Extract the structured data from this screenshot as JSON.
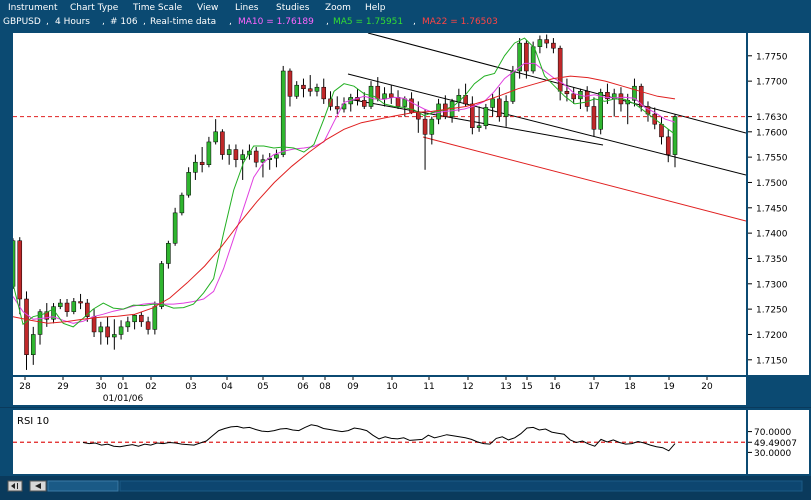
{
  "menu": {
    "items": [
      "Instrument",
      "Chart Type",
      "Time Scale",
      "View",
      "Lines",
      "Studies",
      "Zoom",
      "Help"
    ]
  },
  "info": {
    "symbol": "GBPUSD",
    "timeframe": "4 Hours",
    "bars": "# 106",
    "mode": "Real-time data",
    "ma10": "MA10 = 1.76189",
    "ma5": "MA5 = 1.75951",
    "ma22": "MA22 = 1.76503"
  },
  "colors": {
    "up_candle": "#2fb52f",
    "down_candle": "#c0282a",
    "ma5": "#22b022",
    "ma10": "#e040e0",
    "ma22": "#e02020",
    "frame": "#0b4a72"
  },
  "chart_data": [
    {
      "type": "line",
      "title": "",
      "y_tick_labels": [
        "1.7750",
        "1.7700",
        "1.7630",
        "1.7600",
        "1.7550",
        "1.7500",
        "1.7450",
        "1.7400",
        "1.7350",
        "1.7300",
        "1.7250",
        "1.7200",
        "1.7150"
      ],
      "x_tick_labels": [
        "28",
        "29",
        "30",
        "01",
        "02",
        "03",
        "04",
        "05",
        "06",
        "08",
        "09",
        "10",
        "11",
        "12",
        "13",
        "15",
        "16",
        "17",
        "18",
        "19",
        "20"
      ],
      "date_label": "01/01/06",
      "ylim": [
        1.712,
        1.7795
      ],
      "highlight_price": 1.763,
      "series": [
        {
          "name": "MA10",
          "values": [
            1.7275,
            1.7245,
            1.723,
            1.7232,
            1.7235,
            1.7228,
            1.7222,
            1.7226,
            1.7235,
            1.724,
            1.7246,
            1.725,
            1.7256,
            1.726,
            1.7262,
            1.726,
            1.726,
            1.7262,
            1.7265,
            1.727,
            1.7285,
            1.733,
            1.739,
            1.745,
            1.751,
            1.754,
            1.7555,
            1.7562,
            1.7566,
            1.7568,
            1.7571,
            1.758,
            1.762,
            1.7658,
            1.7664,
            1.767,
            1.7665,
            1.7664,
            1.7668,
            1.7666,
            1.7655,
            1.7645,
            1.7637,
            1.764,
            1.7642,
            1.7645,
            1.7651,
            1.766,
            1.768,
            1.7705,
            1.772,
            1.7735,
            1.7735,
            1.772,
            1.7705,
            1.7693,
            1.7675,
            1.767,
            1.7673,
            1.7668,
            1.7667,
            1.7668,
            1.7666,
            1.7648,
            1.7638,
            1.7625,
            1.7619
          ]
        },
        {
          "name": "MA5",
          "values": [
            1.73,
            1.722,
            1.7235,
            1.724,
            1.725,
            1.7222,
            1.7215,
            1.7232,
            1.725,
            1.7262,
            1.7252,
            1.725,
            1.7258,
            1.7257,
            1.726,
            1.7259,
            1.7252,
            1.7253,
            1.726,
            1.7282,
            1.731,
            1.74,
            1.7485,
            1.754,
            1.7572,
            1.7572,
            1.7568,
            1.757,
            1.7568,
            1.756,
            1.7575,
            1.7625,
            1.768,
            1.7695,
            1.769,
            1.7675,
            1.767,
            1.7655,
            1.765,
            1.7648,
            1.7643,
            1.7632,
            1.7639,
            1.7643,
            1.7652,
            1.767,
            1.7695,
            1.771,
            1.7715,
            1.775,
            1.7775,
            1.7785,
            1.7765,
            1.771,
            1.769,
            1.767,
            1.7655,
            1.7658,
            1.7665,
            1.766,
            1.7665,
            1.7664,
            1.7655,
            1.764,
            1.7625,
            1.761,
            1.7595
          ]
        },
        {
          "name": "MA22",
          "values": [
            1.7235,
            1.7228,
            1.7222,
            1.7225,
            1.723,
            1.7234,
            1.7236,
            1.724,
            1.7252,
            1.7272,
            1.7302,
            1.7335,
            1.7375,
            1.742,
            1.7462,
            1.75,
            1.7532,
            1.756,
            1.7585,
            1.7605,
            1.7618,
            1.7625,
            1.7632,
            1.7638,
            1.764,
            1.7645,
            1.765,
            1.766,
            1.7672,
            1.7685,
            1.7695,
            1.7705,
            1.771,
            1.7707,
            1.77,
            1.769,
            1.768,
            1.767,
            1.7665
          ]
        }
      ],
      "candles_ohlc": [
        [
          1.7295,
          1.739,
          1.729,
          1.7385
        ],
        [
          1.7385,
          1.7392,
          1.724,
          1.727
        ],
        [
          1.727,
          1.7285,
          1.713,
          1.716
        ],
        [
          1.716,
          1.7215,
          1.714,
          1.72
        ],
        [
          1.72,
          1.725,
          1.718,
          1.7245
        ],
        [
          1.7245,
          1.7262,
          1.7215,
          1.723
        ],
        [
          1.723,
          1.7262,
          1.7222,
          1.7255
        ],
        [
          1.7255,
          1.727,
          1.725,
          1.7262
        ],
        [
          1.7262,
          1.727,
          1.7235,
          1.7245
        ],
        [
          1.7245,
          1.7272,
          1.724,
          1.7265
        ],
        [
          1.7265,
          1.728,
          1.725,
          1.7262
        ],
        [
          1.7262,
          1.727,
          1.7225,
          1.7235
        ],
        [
          1.7235,
          1.725,
          1.7195,
          1.7205
        ],
        [
          1.7205,
          1.7225,
          1.718,
          1.7215
        ],
        [
          1.7215,
          1.7235,
          1.718,
          1.7195
        ],
        [
          1.7195,
          1.723,
          1.717,
          1.72
        ],
        [
          1.72,
          1.7228,
          1.719,
          1.7215
        ],
        [
          1.7215,
          1.7235,
          1.7205,
          1.7225
        ],
        [
          1.7225,
          1.724,
          1.721,
          1.7238
        ],
        [
          1.7238,
          1.7245,
          1.7215,
          1.7225
        ],
        [
          1.7225,
          1.7235,
          1.72,
          1.721
        ],
        [
          1.721,
          1.7265,
          1.72,
          1.7255
        ],
        [
          1.7255,
          1.7345,
          1.725,
          1.734
        ],
        [
          1.734,
          1.7385,
          1.733,
          1.738
        ],
        [
          1.738,
          1.745,
          1.7375,
          1.744
        ],
        [
          1.744,
          1.748,
          1.7435,
          1.7475
        ],
        [
          1.7475,
          1.753,
          1.747,
          1.752
        ],
        [
          1.752,
          1.7555,
          1.7505,
          1.754
        ],
        [
          1.754,
          1.757,
          1.752,
          1.7535
        ],
        [
          1.7535,
          1.759,
          1.753,
          1.758
        ],
        [
          1.758,
          1.7625,
          1.7575,
          1.76
        ],
        [
          1.76,
          1.7605,
          1.7545,
          1.7555
        ],
        [
          1.7555,
          1.7575,
          1.7535,
          1.7565
        ],
        [
          1.7565,
          1.7575,
          1.753,
          1.7545
        ],
        [
          1.7545,
          1.7565,
          1.7505,
          1.7555
        ],
        [
          1.7555,
          1.7575,
          1.7545,
          1.7562
        ],
        [
          1.7562,
          1.757,
          1.753,
          1.754
        ],
        [
          1.754,
          1.7555,
          1.751,
          1.7545
        ],
        [
          1.7545,
          1.7558,
          1.7525,
          1.7548
        ],
        [
          1.7548,
          1.7565,
          1.753,
          1.7555
        ],
        [
          1.7555,
          1.773,
          1.755,
          1.772
        ],
        [
          1.772,
          1.7725,
          1.765,
          1.767
        ],
        [
          1.767,
          1.77,
          1.7665,
          1.7692
        ],
        [
          1.7692,
          1.7705,
          1.7668,
          1.7685
        ],
        [
          1.7685,
          1.7712,
          1.767,
          1.768
        ],
        [
          1.768,
          1.7695,
          1.767,
          1.7688
        ],
        [
          1.7688,
          1.7705,
          1.7655,
          1.7665
        ],
        [
          1.7665,
          1.768,
          1.7642,
          1.765
        ],
        [
          1.765,
          1.767,
          1.7635,
          1.7645
        ],
        [
          1.7645,
          1.7668,
          1.7638,
          1.7655
        ],
        [
          1.7655,
          1.7675,
          1.764,
          1.7668
        ],
        [
          1.7668,
          1.7685,
          1.7652,
          1.7662
        ],
        [
          1.7662,
          1.7678,
          1.7645,
          1.765
        ],
        [
          1.765,
          1.77,
          1.7645,
          1.769
        ],
        [
          1.769,
          1.7708,
          1.766,
          1.7665
        ],
        [
          1.7665,
          1.7688,
          1.765,
          1.7675
        ],
        [
          1.7675,
          1.7692,
          1.7655,
          1.7668
        ],
        [
          1.7668,
          1.7682,
          1.7645,
          1.765
        ],
        [
          1.765,
          1.767,
          1.763,
          1.7665
        ],
        [
          1.7665,
          1.7678,
          1.7635,
          1.7638
        ],
        [
          1.7638,
          1.766,
          1.7598,
          1.7625
        ],
        [
          1.7625,
          1.7645,
          1.7525,
          1.7595
        ],
        [
          1.7595,
          1.763,
          1.7575,
          1.7625
        ],
        [
          1.7625,
          1.7665,
          1.7615,
          1.7655
        ],
        [
          1.7655,
          1.7672,
          1.7625,
          1.763
        ],
        [
          1.763,
          1.7665,
          1.7618,
          1.766
        ],
        [
          1.766,
          1.7685,
          1.764,
          1.7672
        ],
        [
          1.7672,
          1.7695,
          1.765,
          1.7655
        ],
        [
          1.7655,
          1.767,
          1.7595,
          1.7608
        ],
        [
          1.7608,
          1.765,
          1.76,
          1.7612
        ],
        [
          1.7612,
          1.7655,
          1.7605,
          1.7648
        ],
        [
          1.7648,
          1.7675,
          1.763,
          1.7665
        ],
        [
          1.7665,
          1.7688,
          1.762,
          1.763
        ],
        [
          1.763,
          1.7672,
          1.761,
          1.766
        ],
        [
          1.766,
          1.773,
          1.7655,
          1.772
        ],
        [
          1.772,
          1.7785,
          1.7705,
          1.7775
        ],
        [
          1.7775,
          1.778,
          1.7705,
          1.772
        ],
        [
          1.772,
          1.7778,
          1.7715,
          1.7768
        ],
        [
          1.7768,
          1.779,
          1.7755,
          1.7782
        ],
        [
          1.7782,
          1.7792,
          1.7765,
          1.7775
        ],
        [
          1.7775,
          1.7785,
          1.7755,
          1.7765
        ],
        [
          1.7765,
          1.777,
          1.7662,
          1.768
        ],
        [
          1.768,
          1.7705,
          1.766,
          1.7675
        ],
        [
          1.7675,
          1.7688,
          1.7655,
          1.7665
        ],
        [
          1.7665,
          1.7685,
          1.7645,
          1.768
        ],
        [
          1.768,
          1.769,
          1.764,
          1.765
        ],
        [
          1.765,
          1.7668,
          1.759,
          1.7605
        ],
        [
          1.7605,
          1.7685,
          1.7595,
          1.7678
        ],
        [
          1.7678,
          1.7695,
          1.7655,
          1.7665
        ],
        [
          1.7665,
          1.7685,
          1.763,
          1.7675
        ],
        [
          1.7675,
          1.7688,
          1.764,
          1.7655
        ],
        [
          1.7655,
          1.7675,
          1.7615,
          1.7662
        ],
        [
          1.7662,
          1.7705,
          1.765,
          1.769
        ],
        [
          1.769,
          1.7695,
          1.764,
          1.765
        ],
        [
          1.765,
          1.766,
          1.762,
          1.7635
        ],
        [
          1.7635,
          1.7648,
          1.7605,
          1.7615
        ],
        [
          1.7615,
          1.763,
          1.7575,
          1.759
        ],
        [
          1.759,
          1.7605,
          1.754,
          1.7555
        ],
        [
          1.7555,
          1.7635,
          1.753,
          1.763
        ]
      ]
    },
    {
      "type": "line",
      "title": "RSI 10",
      "y_tick_labels": [
        "70.0000",
        "49.49007",
        "30.0000"
      ],
      "ylim": [
        0,
        100
      ],
      "highlight_value": 49.49007,
      "series": [
        {
          "name": "RSI 10",
          "values": [
            49,
            47,
            48,
            44,
            46,
            42,
            41,
            43,
            45,
            42,
            46,
            44,
            48,
            47,
            49,
            48,
            46,
            45,
            44,
            48,
            52,
            62,
            72,
            76,
            79,
            80,
            77,
            78,
            74,
            71,
            70,
            72,
            75,
            76,
            73,
            72,
            78,
            83,
            81,
            76,
            74,
            72,
            70,
            72,
            77,
            75,
            72,
            63,
            56,
            60,
            57,
            56,
            58,
            53,
            54,
            55,
            63,
            58,
            61,
            64,
            62,
            60,
            58,
            55,
            50,
            47,
            46,
            57,
            60,
            54,
            58,
            66,
            77,
            78,
            73,
            75,
            69,
            67,
            65,
            54,
            49,
            52,
            46,
            42,
            55,
            50,
            54,
            49,
            46,
            47,
            51,
            48,
            44,
            41,
            39,
            33,
            47
          ]
        }
      ]
    }
  ]
}
